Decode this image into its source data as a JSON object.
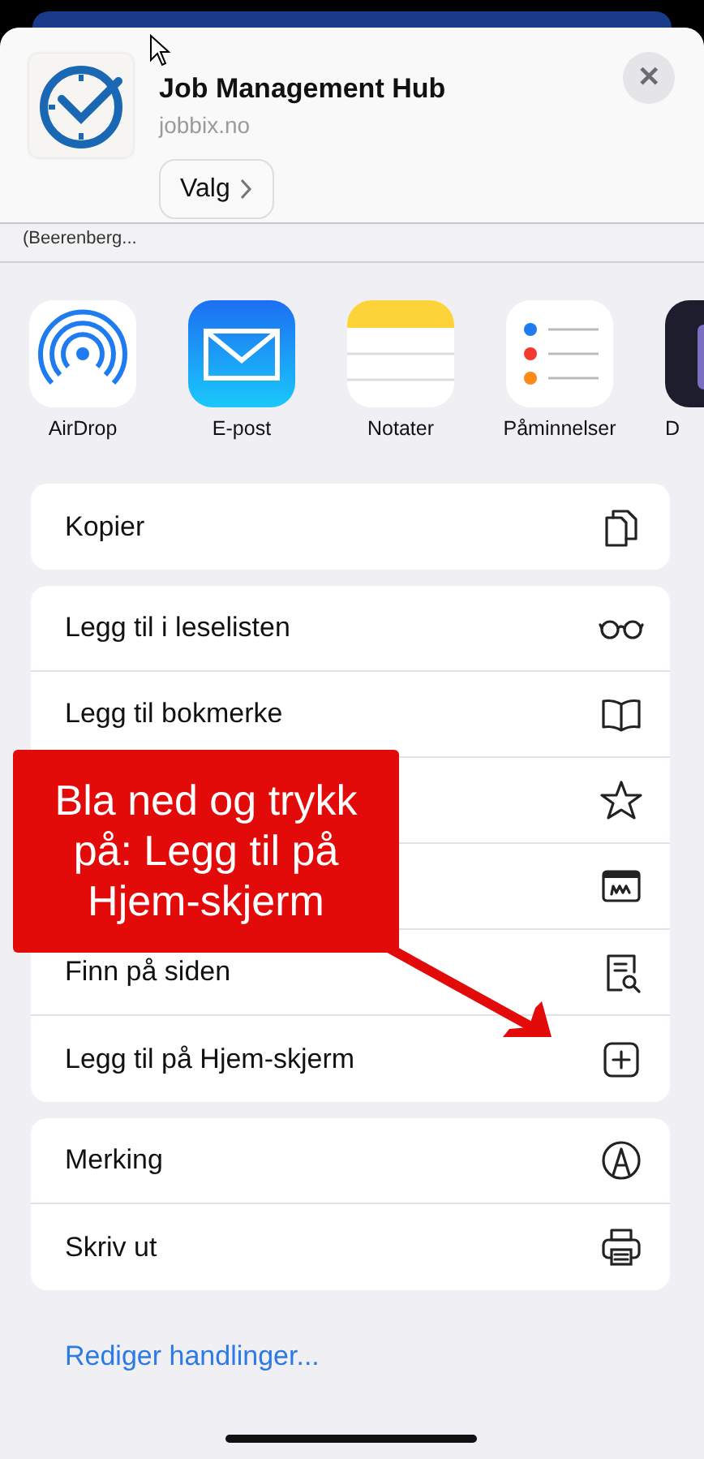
{
  "header": {
    "title": "Job Management Hub",
    "domain": "jobbix.no",
    "options_button": "Valg",
    "close_button": "✕"
  },
  "preview_text": "(Beerenberg...",
  "apps": [
    {
      "label": "AirDrop"
    },
    {
      "label": "E-post"
    },
    {
      "label": "Notater"
    },
    {
      "label": "Påminnelser"
    },
    {
      "label": "D"
    }
  ],
  "action_groups": [
    [
      {
        "kind": "labelled",
        "label": "Kopier"
      }
    ],
    [
      {
        "kind": "labelled",
        "label": "Legg til i leselisten"
      },
      {
        "kind": "labelled",
        "label": "Legg til bokmerke"
      },
      {
        "kind": "icon_only"
      },
      {
        "kind": "icon_only"
      },
      {
        "kind": "labelled",
        "label": "Finn på siden"
      },
      {
        "kind": "labelled",
        "label": "Legg til på Hjem-skjerm"
      }
    ],
    [
      {
        "kind": "labelled",
        "label": "Merking"
      },
      {
        "kind": "labelled",
        "label": "Skriv ut"
      }
    ]
  ],
  "edit_actions_link": "Rediger handlinger...",
  "callout": {
    "text": "Bla ned og trykk på: Legg til på Hjem-skjerm"
  }
}
